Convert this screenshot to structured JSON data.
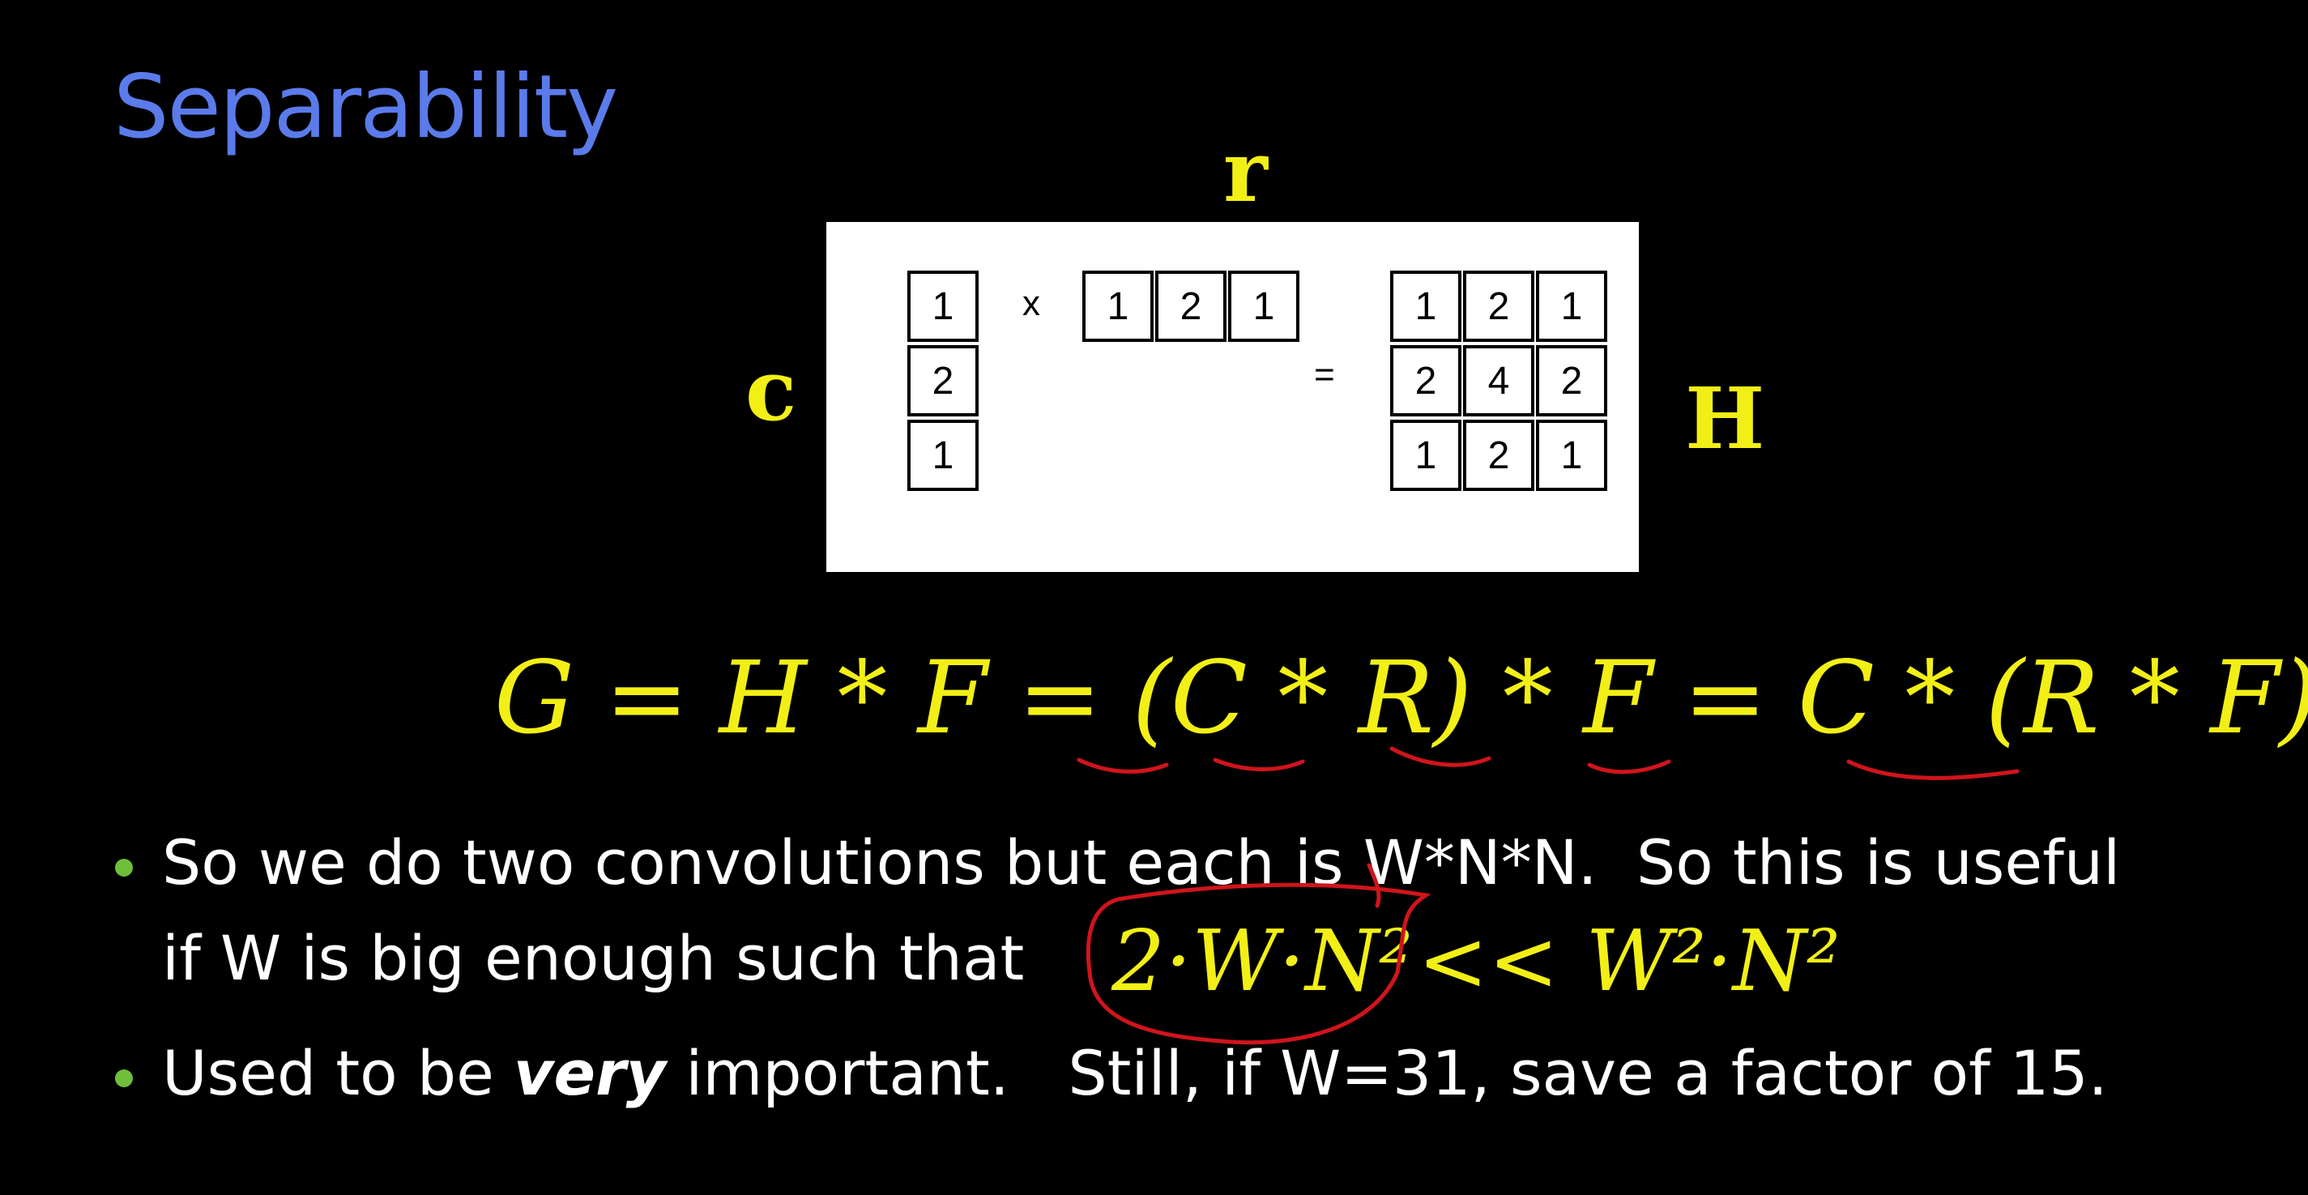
{
  "title": "Separability",
  "labels": {
    "r": "r",
    "c": "c",
    "h": "H"
  },
  "figure": {
    "column_vector": [
      "1",
      "2",
      "1"
    ],
    "times_symbol": "x",
    "row_vector": [
      "1",
      "2",
      "1"
    ],
    "equals_symbol": "=",
    "matrix": [
      [
        "1",
        "2",
        "1"
      ],
      [
        "2",
        "4",
        "2"
      ],
      [
        "1",
        "2",
        "1"
      ]
    ]
  },
  "equation": "G = H * F = (C * R) * F = C * (R * F)",
  "bullets": [
    {
      "line1": "So we do two convolutions but each is W*N*N.  So this is useful",
      "line2": "if W is big enough such that",
      "math_lhs": "2·W·N²",
      "math_rhs": "<< W²·N²"
    },
    {
      "pre": "Used to be ",
      "emph": "very",
      "post": " important.   Still, if W=31, save a factor of 15."
    }
  ],
  "colors": {
    "title": "#5b7bea",
    "math": "#f2ef16",
    "bullet_dot": "#6fbf3a",
    "annotation": "#d0141c"
  }
}
